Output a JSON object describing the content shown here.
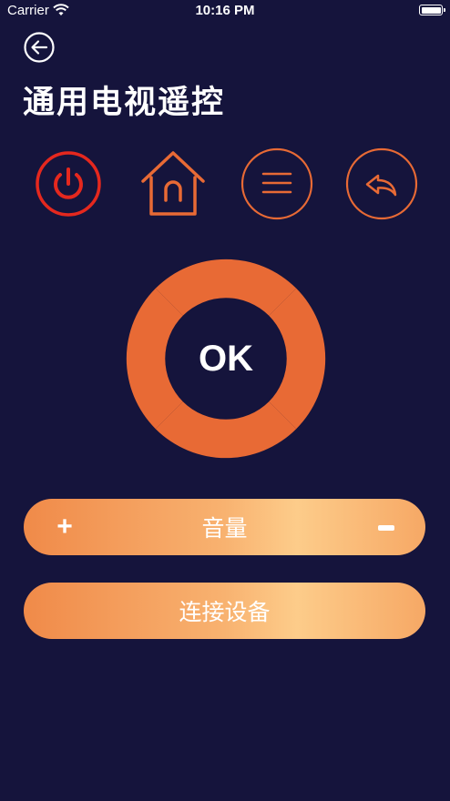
{
  "status_bar": {
    "carrier": "Carrier",
    "time": "10:16 PM"
  },
  "header": {
    "title": "通用电视遥控"
  },
  "controls": {
    "power": "power-icon",
    "home": "home-icon",
    "menu": "menu-icon",
    "return": "return-icon"
  },
  "dpad": {
    "ok_label": "OK"
  },
  "volume": {
    "label": "音量",
    "plus": "+"
  },
  "connect": {
    "label": "连接设备"
  },
  "colors": {
    "background": "#15143c",
    "accent": "#e86a35",
    "power_red": "#e5281e",
    "gradient_start": "#f08a49",
    "gradient_end": "#fdcc8a"
  }
}
